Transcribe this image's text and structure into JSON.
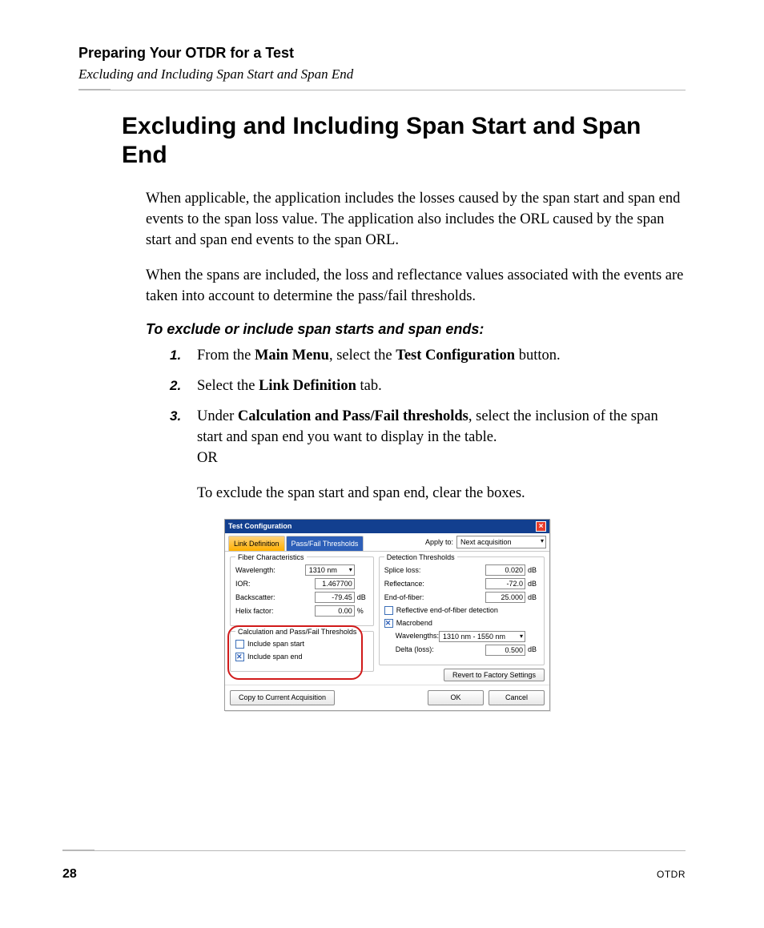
{
  "header": {
    "chapter": "Preparing Your OTDR for a Test",
    "section": "Excluding and Including Span Start and Span End"
  },
  "title": "Excluding and Including Span Start and Span End",
  "para1": "When applicable, the application includes the losses caused by the span start and span end events to the span loss value. The application also includes the ORL caused by the span start and span end events to the span ORL.",
  "para2": "When the spans are included, the loss and reflectance values associated with the events are taken into account to determine the pass/fail thresholds.",
  "procedure_title": "To exclude or include span starts and span ends:",
  "steps": {
    "s1_a": "From the ",
    "s1_b": "Main Menu",
    "s1_c": ", select the ",
    "s1_d": "Test Configuration",
    "s1_e": " button.",
    "s2_a": "Select the ",
    "s2_b": "Link Definition",
    "s2_c": " tab.",
    "s3_a": "Under ",
    "s3_b": "Calculation and Pass/Fail thresholds",
    "s3_c": ", select the inclusion of the span start and span end you want to display in the table.",
    "s3_or": "OR",
    "s3_d": "To exclude the span start and span end, clear the boxes."
  },
  "dialog": {
    "title": "Test Configuration",
    "tabs": {
      "active": "Link Definition",
      "other": "Pass/Fail Thresholds"
    },
    "apply_to_label": "Apply to:",
    "apply_to_value": "Next acquisition",
    "fiber_group": "Fiber Characteristics",
    "fiber": {
      "wavelength_label": "Wavelength:",
      "wavelength_value": "1310 nm",
      "ior_label": "IOR:",
      "ior_value": "1.467700",
      "backscatter_label": "Backscatter:",
      "backscatter_value": "-79.45",
      "backscatter_unit": "dB",
      "helix_label": "Helix factor:",
      "helix_value": "0.00",
      "helix_unit": "%"
    },
    "calc_group": "Calculation and Pass/Fail Thresholds",
    "calc": {
      "include_span_start": "Include span start",
      "include_span_end": "Include span end"
    },
    "detect_group": "Detection Thresholds",
    "detect": {
      "splice_label": "Splice loss:",
      "splice_value": "0.020",
      "refl_label": "Reflectance:",
      "refl_value": "-72.0",
      "eof_label": "End-of-fiber:",
      "eof_value": "25.000",
      "unit_db": "dB",
      "refl_eof_chk": "Reflective end-of-fiber detection",
      "macrobend": "Macrobend",
      "wavelengths_label": "Wavelengths:",
      "wavelengths_value": "1310 nm - 1550 nm",
      "delta_label": "Delta (loss):",
      "delta_value": "0.500"
    },
    "buttons": {
      "revert": "Revert to Factory Settings",
      "copy": "Copy to Current Acquisition",
      "ok": "OK",
      "cancel": "Cancel"
    }
  },
  "footer": {
    "page": "28",
    "doc": "OTDR"
  }
}
